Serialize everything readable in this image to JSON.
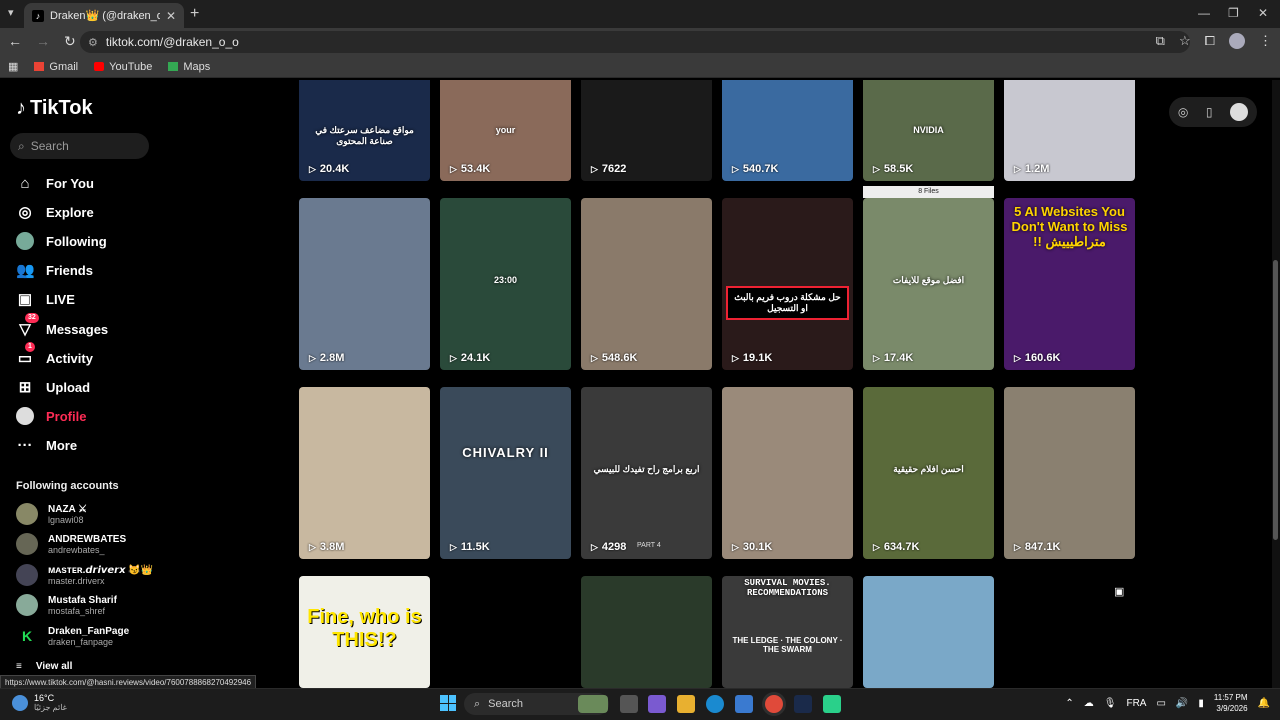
{
  "browser": {
    "tab_title": "Draken👑 (@draken_o_o) | Tik",
    "url": "tiktok.com/@draken_o_o",
    "bookmarks": [
      {
        "label": "Gmail",
        "icon": "gmail-icon",
        "color": "#ea4335"
      },
      {
        "label": "YouTube",
        "icon": "youtube-icon",
        "color": "#ff0000"
      },
      {
        "label": "Maps",
        "icon": "maps-icon",
        "color": "#34a853"
      }
    ],
    "status_url": "https://www.tiktok.com/@hasni.reviews/video/7600788868270492946"
  },
  "sidebar": {
    "brand": "TikTok",
    "search_placeholder": "Search",
    "nav": [
      {
        "label": "For You",
        "icon": "home-icon"
      },
      {
        "label": "Explore",
        "icon": "compass-icon"
      },
      {
        "label": "Following",
        "icon": "following-avatar-icon"
      },
      {
        "label": "Friends",
        "icon": "friends-icon"
      },
      {
        "label": "LIVE",
        "icon": "live-icon"
      },
      {
        "label": "Messages",
        "icon": "messages-icon",
        "badge": "32"
      },
      {
        "label": "Activity",
        "icon": "activity-icon",
        "badge": "1"
      },
      {
        "label": "Upload",
        "icon": "upload-icon"
      },
      {
        "label": "Profile",
        "icon": "profile-avatar-icon",
        "active": true
      },
      {
        "label": "More",
        "icon": "more-icon"
      }
    ],
    "following_header": "Following accounts",
    "accounts": [
      {
        "name": "NAZA ⚔",
        "handle": "lgnawi08",
        "color": "#886"
      },
      {
        "name": "ANDREWBATES",
        "handle": "andrewbates_",
        "color": "#665"
      },
      {
        "name": "ᴍᴀsᴛᴇʀ.𝙙𝙧𝙞𝙫𝙚𝙧𝙭 😼👑",
        "handle": "master.driverx",
        "color": "#445"
      },
      {
        "name": "Mustafa Sharif",
        "handle": "mostafa_shref",
        "color": "#8a9"
      },
      {
        "name": "Draken_FanPage",
        "handle": "draken_fanpage",
        "color": "#2d5"
      }
    ],
    "view_all": "View all"
  },
  "videos": [
    {
      "views": "20.4K",
      "bg": "#1a2a4a",
      "caption": "مواقع مضاعف سرعتك في صناعة المحتوى"
    },
    {
      "views": "53.4K",
      "bg": "#8a6a5a",
      "caption": "your"
    },
    {
      "views": "7622",
      "bg": "#1a1a1a",
      "caption": ""
    },
    {
      "views": "540.7K",
      "bg": "#3a6aa0",
      "caption": ""
    },
    {
      "views": "58.5K",
      "bg": "#5a6a4a",
      "caption": "NVIDIA"
    },
    {
      "views": "1.2M",
      "bg": "#c8c8d0",
      "caption": ""
    },
    {
      "views": "2.8M",
      "bg": "#6a7a90",
      "caption": ""
    },
    {
      "views": "24.1K",
      "bg": "#2a4a3a",
      "caption": "23:00"
    },
    {
      "views": "548.6K",
      "bg": "#8a7a6a",
      "caption": ""
    },
    {
      "views": "19.1K",
      "bg": "#2a1a1a",
      "caption": "حل مشكلة دروب فريم بالبث او التسجيل"
    },
    {
      "views": "17.4K",
      "bg": "#7a8a6a",
      "caption": "افضل موقع للايفات",
      "topbar": "8 Files"
    },
    {
      "views": "160.6K",
      "bg": "#4a1a6a",
      "caption": "5 AI Websites You Don't Want to Miss !! متراطيييش"
    },
    {
      "views": "3.8M",
      "bg": "#c8b8a0",
      "caption": ""
    },
    {
      "views": "11.5K",
      "bg": "#3a4a5a",
      "caption": "CHIVALRY II"
    },
    {
      "views": "4298",
      "bg": "#3a3a3a",
      "caption": "اربع برامج راح تفيدك للبيسي",
      "tag": "PART 4"
    },
    {
      "views": "30.1K",
      "bg": "#9a8a7a",
      "caption": ""
    },
    {
      "views": "634.7K",
      "bg": "#5a6a3a",
      "caption": "احسن افلام حقيقية"
    },
    {
      "views": "847.1K",
      "bg": "#8a8070",
      "caption": ""
    },
    {
      "views": "",
      "bg": "#f0f0e8",
      "caption": "Fine, who is THIS!?"
    },
    {
      "views": "",
      "bg": "#000000",
      "caption": ""
    },
    {
      "views": "",
      "bg": "#2a3a2a",
      "caption": ""
    },
    {
      "views": "",
      "bg": "#3a3a3a",
      "caption": "SURVIVAL MOVIES. RECOMMENDATIONS",
      "sub": "THE LEDGE · THE COLONY · THE SWARM"
    },
    {
      "views": "",
      "bg": "#7aa8c8",
      "caption": ""
    }
  ],
  "taskbar": {
    "weather_temp": "16°C",
    "weather_desc": "غائم جزئيًا",
    "search": "Search",
    "lang": "FRA",
    "time": "11:57 PM",
    "date": "3/9/2026"
  }
}
